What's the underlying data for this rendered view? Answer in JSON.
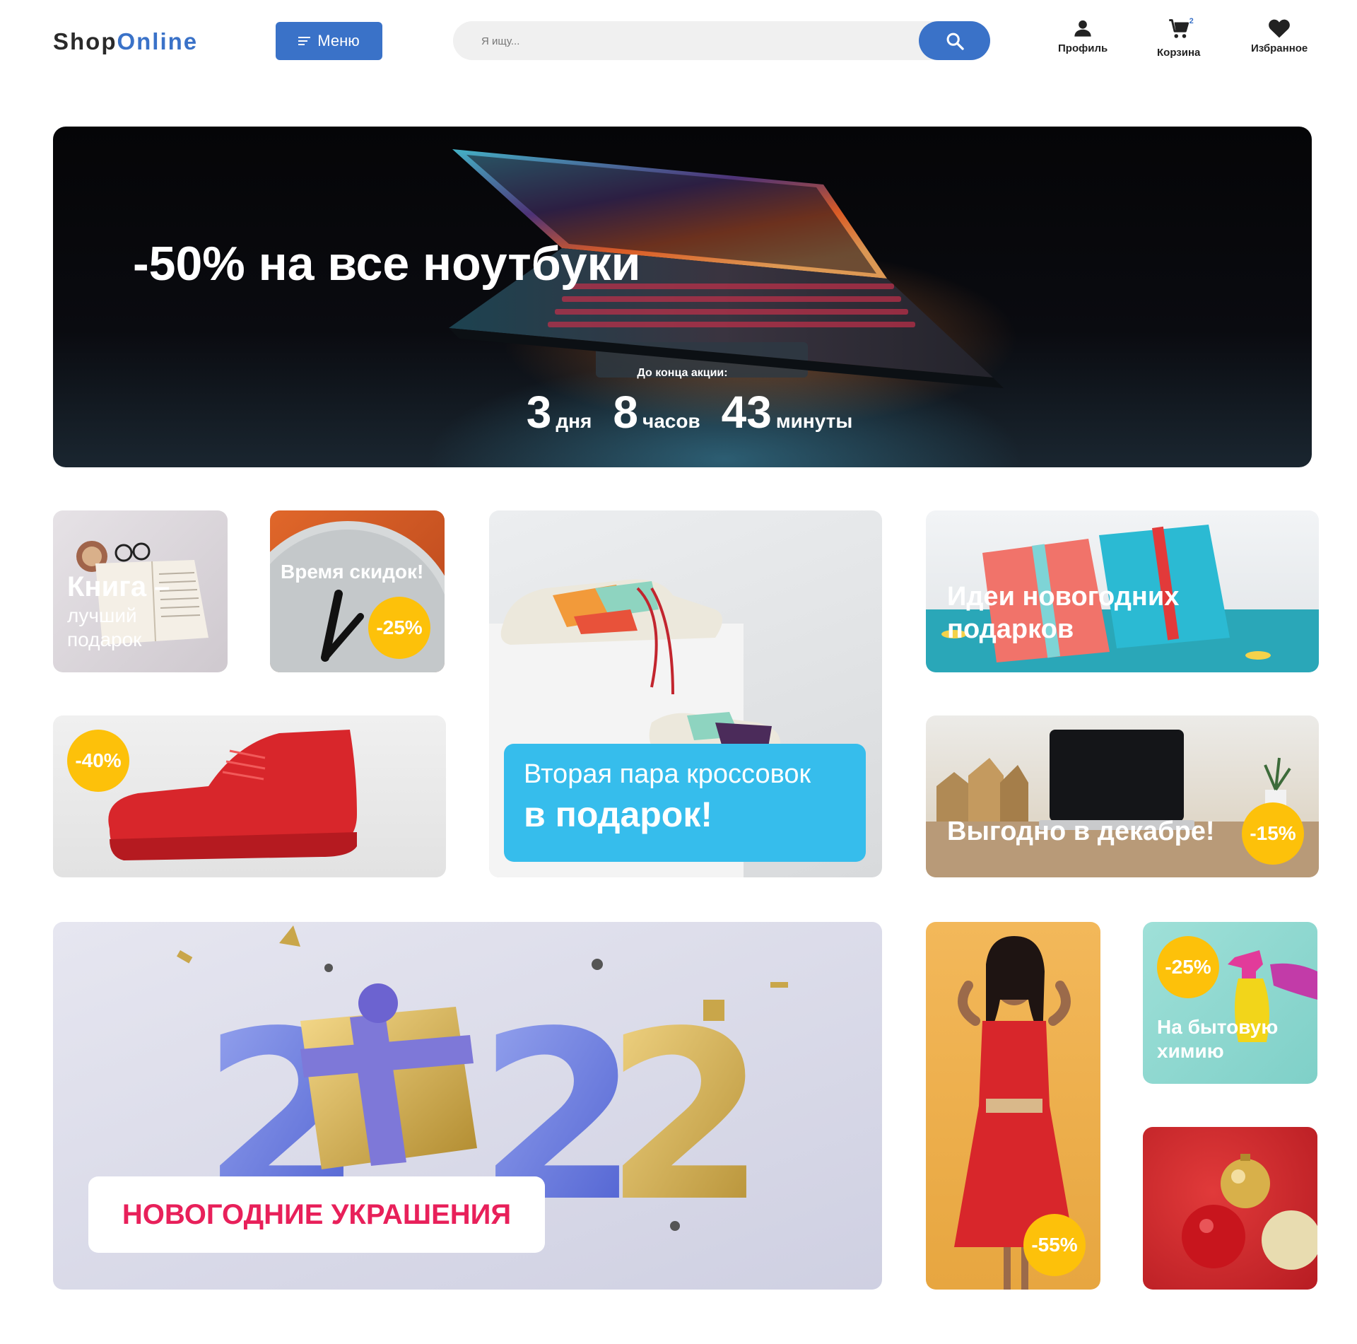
{
  "header": {
    "logo_left": "Shop",
    "logo_right": "Online",
    "menu_label": "Меню",
    "search_placeholder": "Я ищу...",
    "profile_label": "Профиль",
    "cart_label": "Корзина",
    "cart_count": "2",
    "favorites_label": "Избранное"
  },
  "hero": {
    "title": "-50% на все ноутбуки",
    "countdown_label": "До конца акции:",
    "days_num": "3",
    "days_unit": "дня",
    "hours_num": "8",
    "hours_unit": "часов",
    "minutes_num": "43",
    "minutes_unit": "минуты"
  },
  "tiles": {
    "book": {
      "line1": "Книга –",
      "line2": "лучший",
      "line3": "подарок"
    },
    "clock": {
      "title": "Время скидок!",
      "badge": "-25%"
    },
    "sneakers": {
      "line1": "Вторая пара кроссовок",
      "line2": "в подарок!"
    },
    "gifts": {
      "line1": "Идеи новогодних",
      "line2": "подарков"
    },
    "red_shoe": {
      "badge": "-40%"
    },
    "december": {
      "title": "Выгодно в декабре!",
      "badge": "-15%"
    },
    "new_year": {
      "year": "2022",
      "label": "НОВОГОДНИЕ УКРАШЕНИЯ"
    },
    "dress": {
      "badge": "-55%"
    },
    "chemistry": {
      "badge": "-25%",
      "line1": "На бытовую",
      "line2": "химию"
    }
  },
  "colors": {
    "brand_blue": "#3a72c8",
    "badge_yellow": "#fdc10a",
    "sneaker_banner": "#36bdec",
    "decor_text": "#e8205a"
  }
}
